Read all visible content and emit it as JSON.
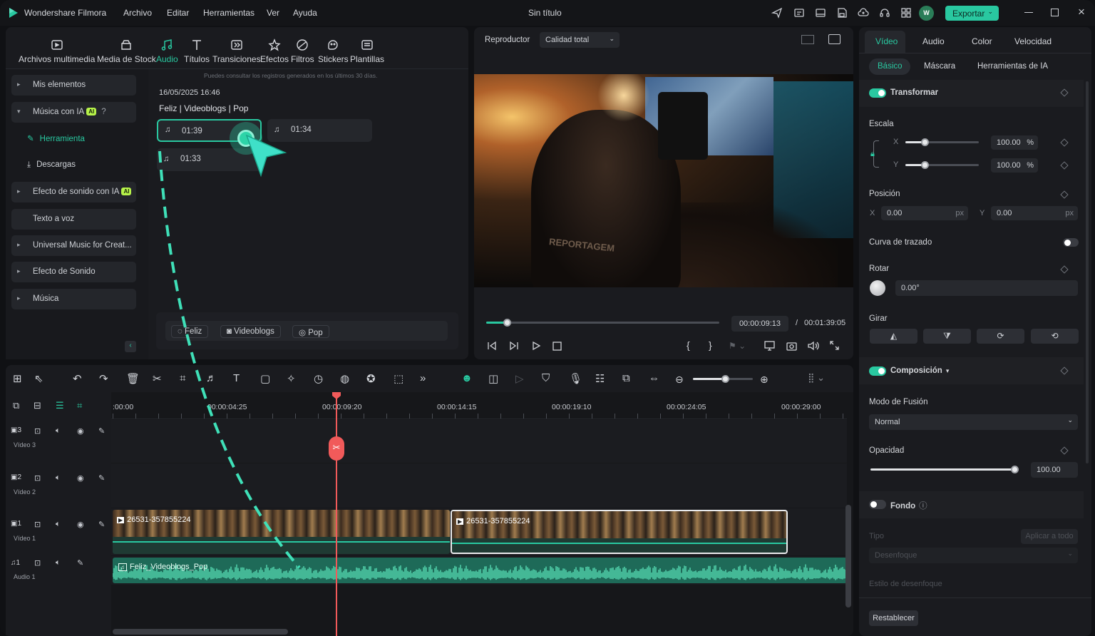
{
  "titlebar": {
    "app_name": "Wondershare Filmora",
    "menus": [
      "Archivo",
      "Editar",
      "Herramientas",
      "Ver",
      "Ayuda"
    ],
    "doc_title": "Sin título",
    "avatar_letter": "W",
    "export_label": "Exportar"
  },
  "media_toolbar": {
    "items": [
      "Archivos multimedia",
      "Media de Stock",
      "Audio",
      "Títulos",
      "Transiciones",
      "Efectos",
      "Filtros",
      "Stickers",
      "Plantillas"
    ],
    "active": "Audio"
  },
  "sidebar": {
    "items": [
      {
        "label": "Mis elementos"
      },
      {
        "label": "Música con IA",
        "badge": "AI"
      },
      {
        "label": "Herramienta"
      },
      {
        "label": "Descargas"
      },
      {
        "label": "Efecto de sonido con IA",
        "badge": "AI"
      },
      {
        "label": "Texto a voz"
      },
      {
        "label": "Universal Music for Creat..."
      },
      {
        "label": "Efecto de Sonido"
      },
      {
        "label": "Música"
      }
    ]
  },
  "ai_music": {
    "hint": "Puedes consultar los registros generados en los últimos 30 días.",
    "date": "16/05/2025 16:46",
    "tags_line": "Feliz | Videoblogs | Pop",
    "clips": [
      "01:39",
      "01:34",
      "01:33"
    ],
    "tags": [
      "Feliz",
      "Videoblogs",
      "Pop"
    ]
  },
  "player": {
    "label": "Reproductor",
    "quality": "Calidad total",
    "current_time": "00:00:09:13",
    "separator": "/",
    "total_time": "00:01:39:05",
    "progress_fraction": 0.09,
    "video_text": "REPORTAGEM"
  },
  "properties": {
    "tabs": [
      "Vídeo",
      "Audio",
      "Color",
      "Velocidad"
    ],
    "active_tab": "Vídeo",
    "subtabs": [
      "Básico",
      "Máscara",
      "Herramientas de IA"
    ],
    "active_subtab": "Básico",
    "transform_label": "Transformar",
    "scale_label": "Escala",
    "x_label": "X",
    "y_label": "Y",
    "scale_x": "100.00",
    "scale_y": "100.00",
    "percent": "%",
    "position_label": "Posición",
    "pos_x": "0.00",
    "pos_y": "0.00",
    "px": "px",
    "path_curve_label": "Curva de trazado",
    "rotate_label": "Rotar",
    "rotate_value": "0.00°",
    "flip_label": "Girar",
    "composition_label": "Composición",
    "blend_label": "Modo de Fusión",
    "blend_value": "Normal",
    "opacity_label": "Opacidad",
    "opacity_value": "100.00",
    "background_label": "Fondo",
    "type_label": "Tipo",
    "apply_all": "Aplicar a todo",
    "blur_value": "Desenfoque",
    "blur_style_label": "Estilo de desenfoque",
    "reset_label": "Restablecer"
  },
  "timeline": {
    "ticks": [
      ":00:00",
      "00:00:04:25",
      "00:00:09:20",
      "00:00:14:15",
      "00:00:19:10",
      "00:00:24:05",
      "00:00:29:00"
    ],
    "tracks": [
      {
        "num": "3",
        "name": "Vídeo 3"
      },
      {
        "num": "2",
        "name": "Vídeo 2"
      },
      {
        "num": "1",
        "name": "Vídeo 1"
      },
      {
        "num": "1",
        "name": "Audio 1"
      }
    ],
    "clip1_name": "26531-357855224",
    "clip2_name": "26531-357855224",
    "audio_clip_name": "Feliz_Videoblogs_Pop"
  },
  "colors": {
    "accent": "#29c8a0",
    "playhead": "#f15a5a",
    "ai_badge": "#b7f34a"
  }
}
